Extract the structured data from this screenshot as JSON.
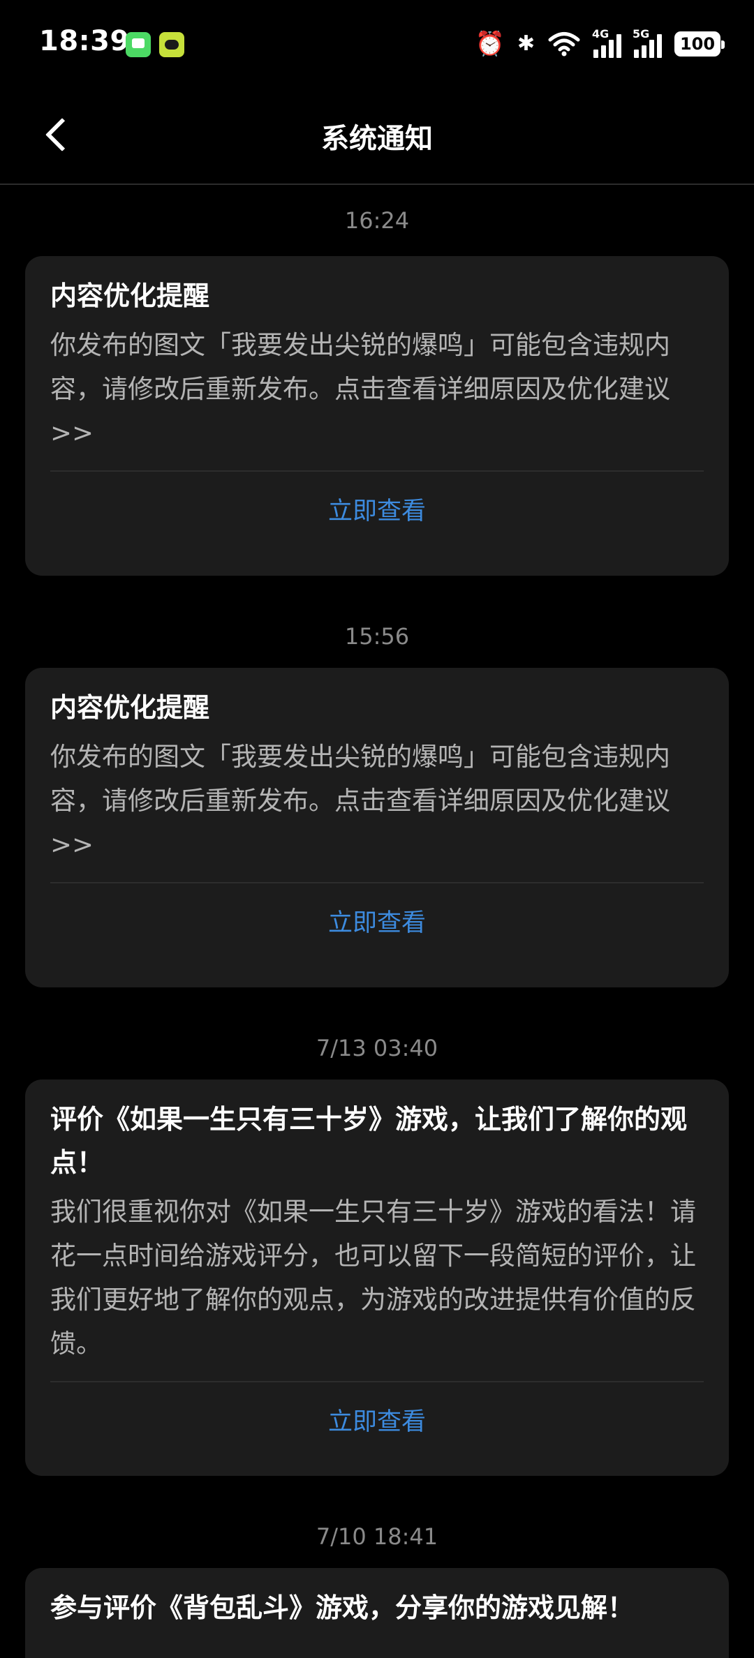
{
  "status_bar": {
    "time": "18:39",
    "wifi_icon": "wifi-icon",
    "network_4g": "4G",
    "network_5g": "5G",
    "battery": "100"
  },
  "nav": {
    "title": "系统通知",
    "back_icon": "chevron-left-icon"
  },
  "notifications": [
    {
      "time": "16:24",
      "title": "内容优化提醒",
      "body": "你发布的图文「我要发出尖锐的爆鸣」可能包含违规内容，请修改后重新发布。点击查看详细原因及优化建议>>",
      "action": "立即查看"
    },
    {
      "time": "15:56",
      "title": "内容优化提醒",
      "body": "你发布的图文「我要发出尖锐的爆鸣」可能包含违规内容，请修改后重新发布。点击查看详细原因及优化建议>>",
      "action": "立即查看"
    },
    {
      "time": "7/13  03:40",
      "title": "评价《如果一生只有三十岁》游戏，让我们了解你的观点！",
      "body": "我们很重视你对《如果一生只有三十岁》游戏的看法！请花一点时间给游戏评分，也可以留下一段简短的评价，让我们更好地了解你的观点，为游戏的改进提供有价值的反馈。",
      "action": "立即查看"
    },
    {
      "time": "7/10  18:41",
      "title": "参与评价《背包乱斗》游戏，分享你的游戏见解！"
    }
  ],
  "colors": {
    "background": "#000000",
    "card": "#1c1c1c",
    "accent": "#3d8bdf",
    "muted_text": "#8a8a8a"
  }
}
